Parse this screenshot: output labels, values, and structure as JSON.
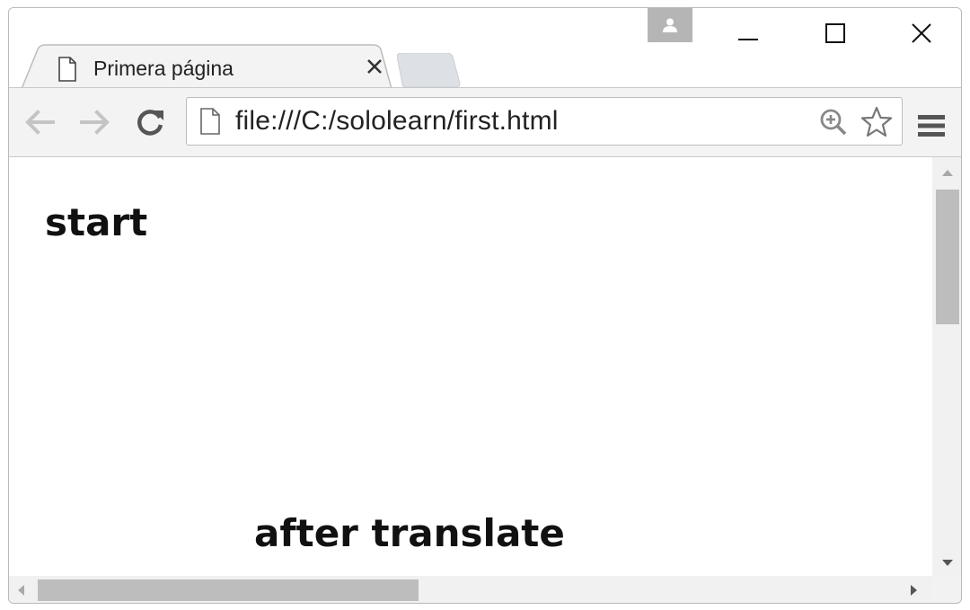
{
  "tab": {
    "title": "Primera página",
    "page_icon": "page-icon",
    "close_icon": "close-icon"
  },
  "window_controls": {
    "profile_icon": "person-icon",
    "minimize_icon": "minimize-icon",
    "maximize_icon": "maximize-icon",
    "close_icon": "close-icon"
  },
  "toolbar": {
    "back_icon": "arrow-left-icon",
    "forward_icon": "arrow-right-icon",
    "reload_icon": "reload-icon",
    "url": "file:///C:/sololearn/first.html",
    "zoom_icon": "zoom-in-icon",
    "bookmark_icon": "star-icon",
    "menu_icon": "hamburger-menu-icon"
  },
  "page": {
    "heading_start": "start",
    "heading_after": "after translate"
  }
}
